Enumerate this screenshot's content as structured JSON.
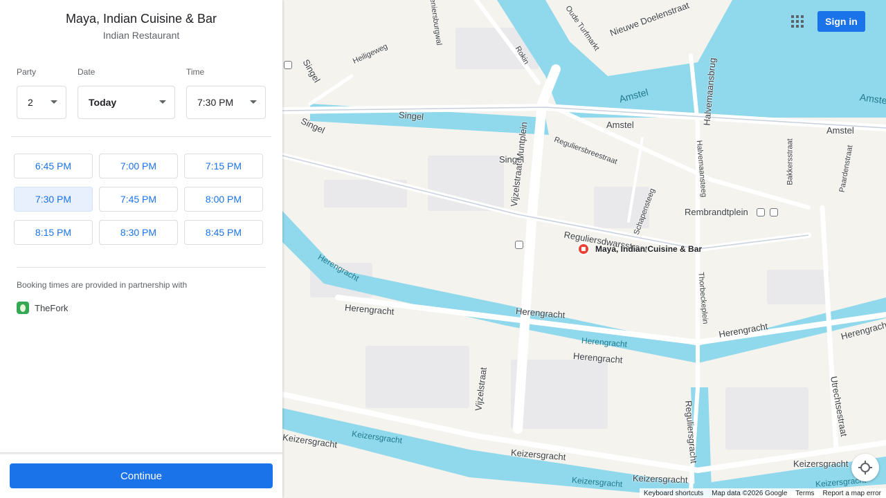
{
  "restaurant": {
    "name": "Maya, Indian Cuisine & Bar",
    "type": "Indian Restaurant"
  },
  "booking": {
    "party_label": "Party",
    "party_value": "2",
    "date_label": "Date",
    "date_value": "Today",
    "time_label": "Time",
    "time_value": "7:30 PM",
    "slots": [
      "6:45 PM",
      "7:00 PM",
      "7:15 PM",
      "7:30 PM",
      "7:45 PM",
      "8:00 PM",
      "8:15 PM",
      "8:30 PM",
      "8:45 PM"
    ],
    "selected_slot": "7:30 PM",
    "partner_text": "Booking times are provided in partnership with",
    "partner_name": "TheFork",
    "continue_label": "Continue"
  },
  "map": {
    "sign_in": "Sign in",
    "apps_icon": "apps-grid-icon",
    "pin_label": "Maya, Indian Cuisine & Bar",
    "streets": {
      "singel_top": "Singel",
      "singel_mid": "Singel",
      "singel_left": "Singel",
      "singel_south": "Singel",
      "amstel": "Amstel",
      "amstel_water": "Amstel",
      "amstel_water_right": "Amstel",
      "amstel_right": "Amstel",
      "nieuwe_doelenstraat": "Nieuwe Doelenstraat",
      "oude_turfmarkt": "Oude Turfmarkt",
      "rokin": "Rokin",
      "heiligeweg": "Heiligeweg",
      "halvemaansbrug": "Halvemaansbrug",
      "halvemaansteeg": "Halvemaansteeg",
      "reguliersbreestraat": "Reguliersbreestraat",
      "bakkersstraat": "Bakkersstraat",
      "paardenstraat": "Paardenstraat",
      "rembrandtplein": "Rembrandtplein",
      "schapensteeg": "Schapensteeg",
      "reguliersdwarsstraat": "Reguliersdwarsstraat",
      "vijzelstraat_muntplein": "Vijzelstraat Muntplein",
      "vijzelstraat": "Vijzelstraat",
      "herengracht_1": "Herengracht",
      "herengracht_2": "Herengracht",
      "herengracht_3": "Herengracht",
      "herengracht_4": "Herengracht",
      "herengracht_5": "Herengracht",
      "herengracht_water_1": "Herengracht",
      "herengracht_water_2": "Herengracht",
      "thorbeckeplein": "Thorbeckeplein",
      "utrechtsestraat": "Utrechtsestraat",
      "reguliersgracht": "Reguliersgracht",
      "keizersgracht_1": "Keizersgracht",
      "keizersgracht_2": "Keizersgracht",
      "keizersgracht_3": "Keizersgracht",
      "keizersgracht_4": "Keizersgracht",
      "keizersgracht_water_1": "Keizersgracht",
      "keizersgracht_water_2": "Keizersgracht",
      "keizersgracht_water_3": "Keizersgracht",
      "kloveniersburgwal": "Kloveniersburgwal"
    },
    "footer": {
      "shortcuts": "Keyboard shortcuts",
      "data": "Map data ©2026 Google",
      "terms": "Terms",
      "report": "Report a map error"
    },
    "colors": {
      "water": "#90d8ec",
      "road": "#ffffff",
      "land": "#f4f3ee",
      "accent": "#1a73e8"
    }
  }
}
